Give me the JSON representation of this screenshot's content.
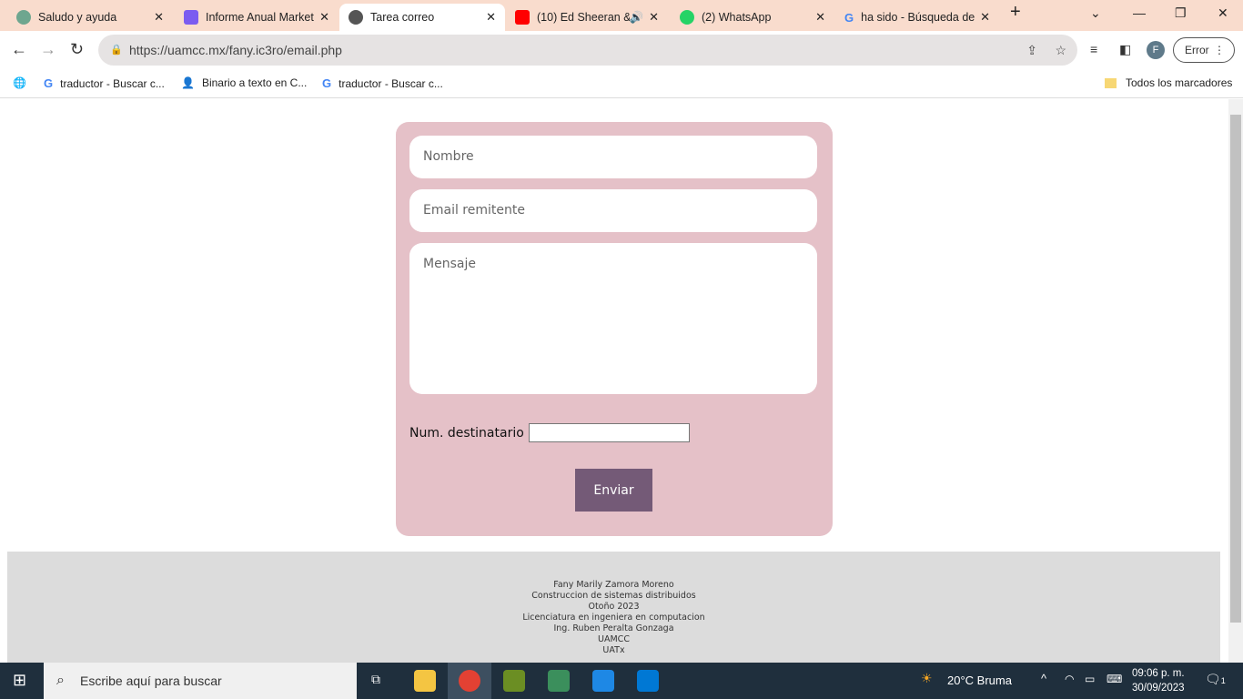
{
  "browser": {
    "tabs": [
      {
        "label": "Saludo y ayuda",
        "icon": "chatgpt-icon",
        "color": "#6ea68f"
      },
      {
        "label": "Informe Anual Marketing",
        "icon": "app-icon",
        "color": "#7b5cf0"
      },
      {
        "label": "Tarea correo",
        "icon": "globe-icon",
        "color": "#555555"
      },
      {
        "label": "(10) Ed Sheeran & ...",
        "icon": "youtube-icon",
        "color": "#ff0000"
      },
      {
        "label": "(2) WhatsApp",
        "icon": "whatsapp-icon",
        "color": "#25d366"
      },
      {
        "label": "ha sido - Búsqueda de Google",
        "icon": "google-icon",
        "color": "#4285f4"
      }
    ],
    "url": "https://uamcc.mx/fany.ic3ro/email.php",
    "profile_initial": "F",
    "error_label": "Error",
    "bookmarks": [
      {
        "label": "traductor - Buscar c...",
        "icon": "google-icon"
      },
      {
        "label": "Binario a texto en C...",
        "icon": "person-icon"
      },
      {
        "label": "traductor - Buscar c...",
        "icon": "google-icon"
      }
    ],
    "all_bookmarks": "Todos los marcadores"
  },
  "form": {
    "name_placeholder": "Nombre",
    "email_placeholder": "Email remitente",
    "message_placeholder": "Mensaje",
    "num_label": "Num. destinatario",
    "num_value": "",
    "submit_label": "Enviar",
    "card_color": "#e5c1c8",
    "button_color": "#745a77"
  },
  "footer": {
    "lines": [
      "Fany Marily Zamora Moreno",
      "Construccion de sistemas distribuidos",
      "Otoño 2023",
      "Licenciatura en ingeniera en computacion",
      "Ing. Ruben Peralta Gonzaga",
      "UAMCC",
      "UATx"
    ]
  },
  "taskbar": {
    "search_placeholder": "Escribe aquí para buscar",
    "weather": "20°C  Bruma",
    "time": "09:06 p. m.",
    "date": "30/09/2023",
    "notifications": "1"
  }
}
